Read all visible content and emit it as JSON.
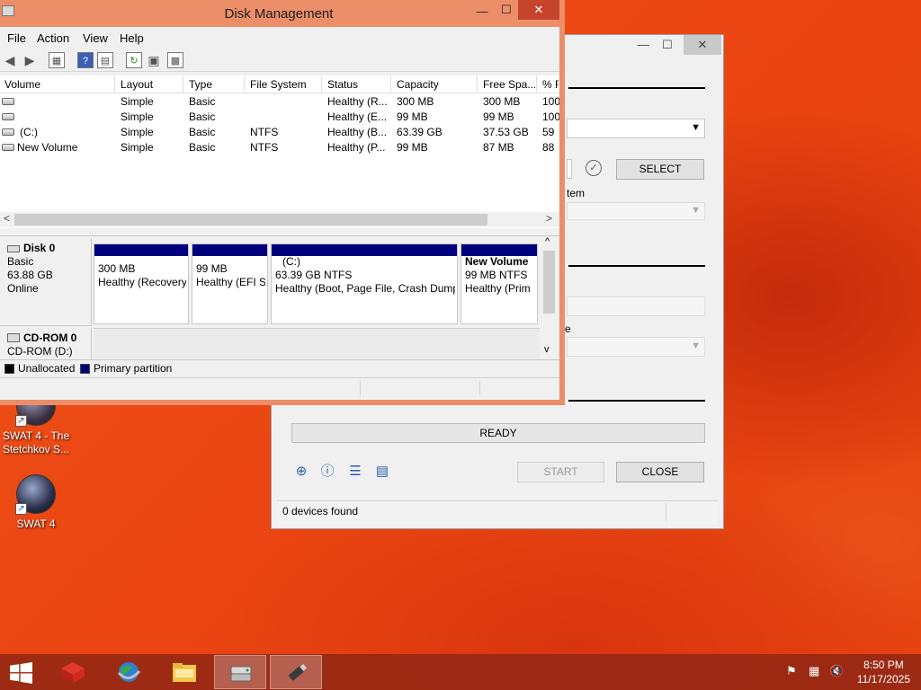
{
  "desktop": {
    "icons": [
      {
        "label": "SWAT 4 - The Stetchkov S..."
      },
      {
        "label": "SWAT 4"
      }
    ]
  },
  "back_window": {
    "controls": {
      "min": "—",
      "max": "☐",
      "close": "✕"
    },
    "label_system": "tem",
    "label_e": "e",
    "select_button": "SELECT",
    "status_text": "READY",
    "start_button": "START",
    "close_button": "CLOSE",
    "statusbar": "0 devices found"
  },
  "disk_management": {
    "title": "Disk Management",
    "controls": {
      "min": "—",
      "max": "☐",
      "close": "✕"
    },
    "menu": [
      "File",
      "Action",
      "View",
      "Help"
    ],
    "columns": [
      "Volume",
      "Layout",
      "Type",
      "File System",
      "Status",
      "Capacity",
      "Free Spa...",
      "% F"
    ],
    "rows": [
      {
        "volume": "",
        "layout": "Simple",
        "type": "Basic",
        "fs": "",
        "status": "Healthy (R...",
        "capacity": "300 MB",
        "free": "300 MB",
        "pct": "100"
      },
      {
        "volume": "",
        "layout": "Simple",
        "type": "Basic",
        "fs": "",
        "status": "Healthy (E...",
        "capacity": "99 MB",
        "free": "99 MB",
        "pct": "100"
      },
      {
        "volume": "(C:)",
        "layout": "Simple",
        "type": "Basic",
        "fs": "NTFS",
        "status": "Healthy (B...",
        "capacity": "63.39 GB",
        "free": "37.53 GB",
        "pct": "59"
      },
      {
        "volume": "New Volume",
        "layout": "Simple",
        "type": "Basic",
        "fs": "NTFS",
        "status": "Healthy (P...",
        "capacity": "99 MB",
        "free": "87 MB",
        "pct": "88"
      }
    ],
    "disk0": {
      "name": "Disk 0",
      "type": "Basic",
      "size": "63.88 GB",
      "state": "Online",
      "partitions": [
        {
          "title": "",
          "size": "300 MB",
          "status": "Healthy (Recovery"
        },
        {
          "title": "",
          "size": "99 MB",
          "status": "Healthy (EFI S"
        },
        {
          "title": "(C:)",
          "size": "63.39 GB NTFS",
          "status": "Healthy (Boot, Page File, Crash Dump"
        },
        {
          "title": "New Volume",
          "size": "99 MB NTFS",
          "status": "Healthy (Prim"
        }
      ]
    },
    "cdrom": {
      "name": "CD-ROM 0",
      "sub": "CD-ROM (D:)"
    },
    "legend": [
      {
        "label": "Unallocated",
        "color": "#000000"
      },
      {
        "label": "Primary partition",
        "color": "#00007f"
      }
    ]
  },
  "taskbar": {
    "clock_time": "8:50 PM",
    "clock_date": "11/17/2025"
  },
  "colors": {
    "dm_frame": "#ec8e67",
    "partition_bar": "#00007f",
    "taskbar": "#96281a"
  }
}
